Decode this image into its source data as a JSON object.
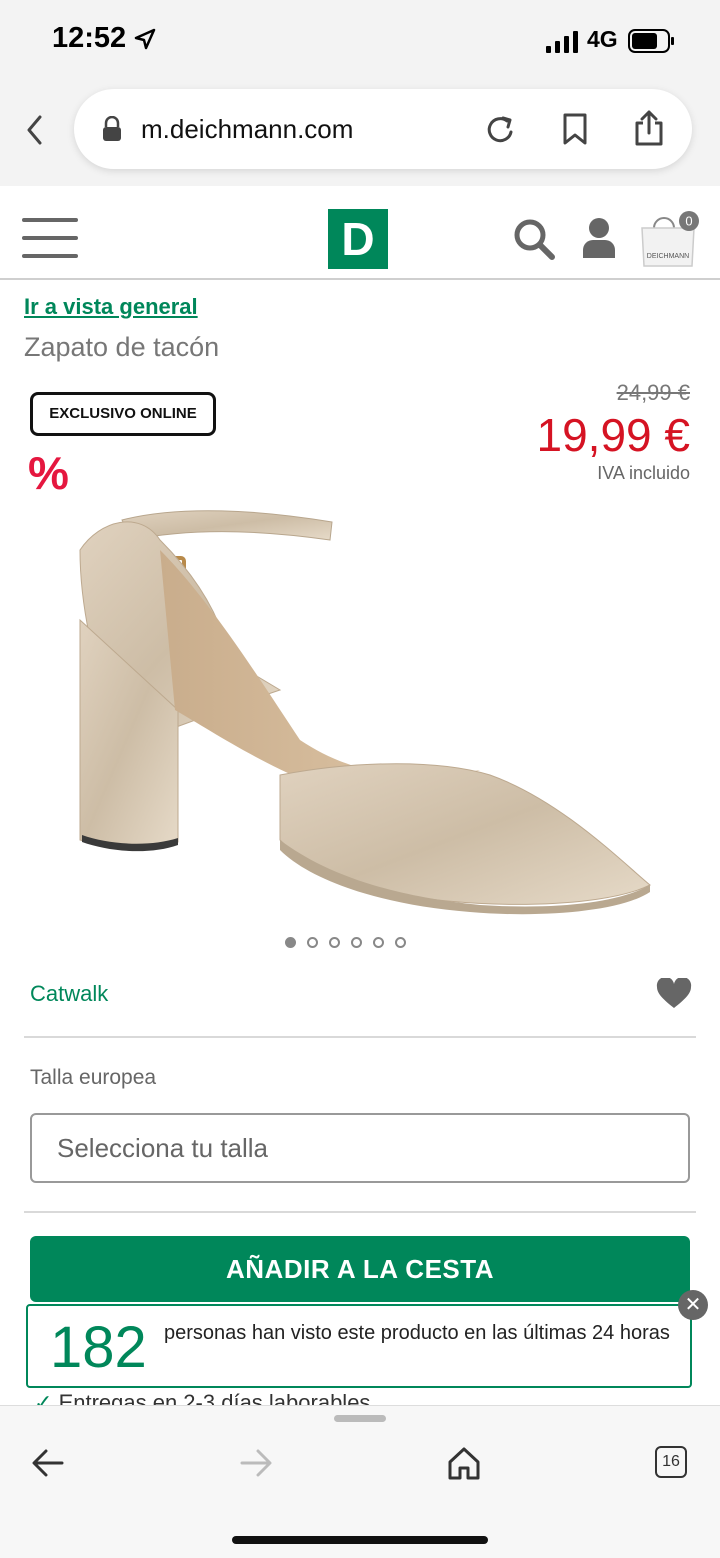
{
  "status_bar": {
    "time": "12:52",
    "network": "4G"
  },
  "browser": {
    "url": "m.deichmann.com",
    "tab_count": "16"
  },
  "header": {
    "logo_letter": "D",
    "cart_count": "0",
    "cart_bag_label": "DEICHMANN"
  },
  "product": {
    "back_link": "Ir a vista general",
    "title": "Zapato de tacón",
    "badge": "EXCLUSIVO ONLINE",
    "discount_symbol": "%",
    "old_price": "24,99 €",
    "price": "19,99 €",
    "vat_note": "IVA incluido",
    "brand": "Catwalk",
    "size_label": "Talla europea",
    "size_placeholder": "Selecciona tu talla",
    "add_to_cart": "AÑADIR A LA CESTA",
    "image_count": 6,
    "active_image": 1
  },
  "banner": {
    "count": "182",
    "text": "personas han visto este producto en las últimas 24 horas"
  },
  "delivery": "Entregas en 2-3 días laborables",
  "colors": {
    "brand_green": "#00875a",
    "price_red": "#d51323",
    "badge_red": "#e5173f"
  }
}
